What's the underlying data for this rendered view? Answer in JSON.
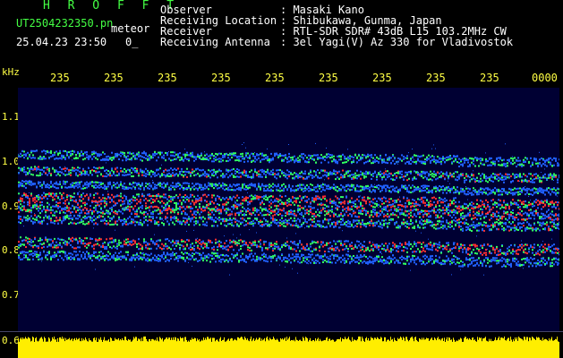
{
  "header": {
    "brand": "H R O F F T",
    "file_name": "UT2504232350.pn",
    "meteor_label": "meteor",
    "datetime": "25.04.23 23:50",
    "count": "0_",
    "info": [
      {
        "label": "Observer",
        "value": ": Masaki Kano"
      },
      {
        "label": "Receiving Location",
        "value": ": Shibukawa, Gunma, Japan"
      },
      {
        "label": "Receiver",
        "value": ": RTL-SDR SDR# 43dB L15 103.2MHz CW"
      },
      {
        "label": "Receiving Antenna",
        "value": ": 3el Yagi(V) Az 330 for Vladivostok"
      }
    ]
  },
  "axis": {
    "unit": "kHz",
    "time_ticks": [
      "235",
      "235",
      "235",
      "235",
      "235",
      "235",
      "235",
      "235",
      "235",
      "0000"
    ],
    "freq_labels": [
      "1.1",
      "1.0",
      "0.9",
      "0.8",
      "0.7",
      "0.6"
    ]
  },
  "colors": {
    "background": "#000000",
    "plot_bg": "#000033",
    "label_yellow": "#ffff44",
    "brand_green": "#44ff44",
    "signal_strong": "#ff3030",
    "signal_mid": "#30ff60",
    "signal_weak": "#2060ff",
    "power_bar": "#ffee00"
  }
}
